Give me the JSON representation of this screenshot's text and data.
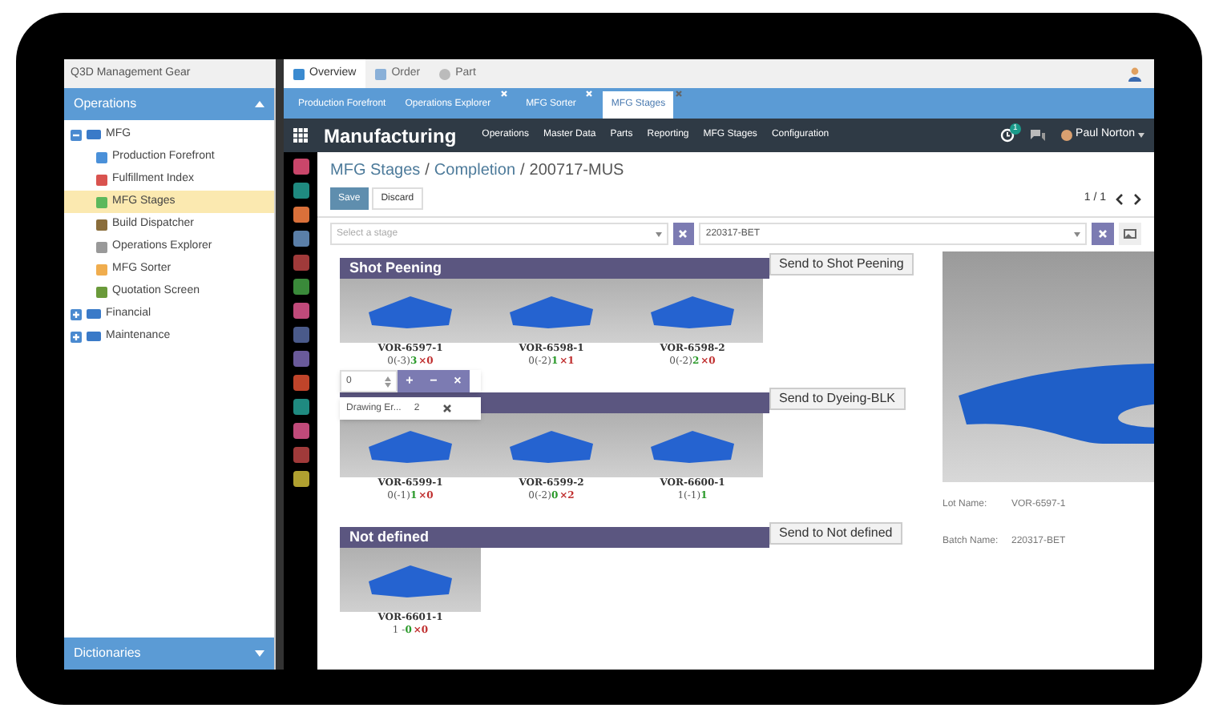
{
  "top_bar": {
    "app_title": "Q3D Management Gear",
    "tabs": [
      {
        "label": "Overview",
        "selected": true
      },
      {
        "label": "Order",
        "selected": false
      },
      {
        "label": "Part",
        "selected": false
      }
    ]
  },
  "sidebar": {
    "header": "Operations",
    "footer": "Dictionaries",
    "tree": [
      {
        "label": "MFG",
        "expanded": true,
        "children": [
          {
            "label": "Production Forefront",
            "selected": false,
            "color": "#4a90d9"
          },
          {
            "label": "Fulfillment Index",
            "selected": false,
            "color": "#d9534f"
          },
          {
            "label": "MFG Stages",
            "selected": true,
            "color": "#5cb85c"
          },
          {
            "label": "Build Dispatcher",
            "selected": false,
            "color": "#8a6d3b"
          },
          {
            "label": "Operations Explorer",
            "selected": false,
            "color": "#999999"
          },
          {
            "label": "MFG Sorter",
            "selected": false,
            "color": "#f0ad4e"
          },
          {
            "label": "Quotation Screen",
            "selected": false,
            "color": "#6a9a3a"
          }
        ]
      },
      {
        "label": "Financial",
        "expanded": false
      },
      {
        "label": "Maintenance",
        "expanded": false
      }
    ]
  },
  "doc_tabs": [
    {
      "label": "Production Forefront",
      "closable": false,
      "selected": false
    },
    {
      "label": "Operations Explorer",
      "closable": true,
      "selected": false
    },
    {
      "label": "MFG Sorter",
      "closable": true,
      "selected": false
    },
    {
      "label": "MFG Stages",
      "closable": true,
      "selected": true
    }
  ],
  "navbar": {
    "title": "Manufacturing",
    "menu": [
      "Operations",
      "Master Data",
      "Parts",
      "Reporting",
      "MFG Stages",
      "Configuration"
    ],
    "notification_count": "1",
    "user": "Paul Norton"
  },
  "app_icons": [
    {
      "color": "#c9466a"
    },
    {
      "color": "#1f8a80"
    },
    {
      "color": "#d9703a"
    },
    {
      "color": "#5a7fa8"
    },
    {
      "color": "#a03a3a"
    },
    {
      "color": "#3a8a3a"
    },
    {
      "color": "#c04a7a"
    },
    {
      "color": "#4a5a8a"
    },
    {
      "color": "#6a5a9a"
    },
    {
      "color": "#c0442a"
    },
    {
      "color": "#1f8a80"
    },
    {
      "color": "#c04a7a"
    },
    {
      "color": "#a03a3a"
    },
    {
      "color": "#b0a030"
    }
  ],
  "breadcrumb": {
    "separator": "/",
    "items": [
      "MFG Stages",
      "Completion",
      "200717-MUS"
    ]
  },
  "buttons": [
    "Save",
    "Discard"
  ],
  "pager": "1 / 1",
  "filters": {
    "stage_placeholder": "Select a stage",
    "batch": "220317-BET"
  },
  "groups": [
    {
      "title": "Shot Peening",
      "action": "Send to Shot Peening",
      "parts": [
        {
          "lot": "VOR-6597-1",
          "count": "0(-3)",
          "good": "3",
          "bad": "×0"
        },
        {
          "lot": "VOR-6598-1",
          "count": "0(-2)",
          "good": "1",
          "bad": "×1"
        },
        {
          "lot": "VOR-6598-2",
          "count": "0(-2)",
          "good": "2",
          "bad": "×0"
        }
      ]
    },
    {
      "action": "Send to Dyeing-BLK",
      "parts": [
        {
          "lot": "VOR-6599-1",
          "count": "0(-1)",
          "good": "1",
          "bad": "×0"
        },
        {
          "lot": "VOR-6599-2",
          "count": "0(-2)",
          "good": "0",
          "bad": "×2"
        },
        {
          "lot": "VOR-6600-1",
          "count": "1(-1)",
          "good": "1"
        }
      ]
    },
    {
      "title": "Not defined",
      "action": "Send to Not defined",
      "parts": [
        {
          "lot": "VOR-6601-1",
          "count": "1 -",
          "good": "0",
          "bad": "×0"
        }
      ]
    }
  ],
  "quantity_popup": {
    "value": "0",
    "buttons": [
      "+",
      "−",
      "×"
    ],
    "tooltip": {
      "label": "Drawing Er...",
      "value": "2"
    }
  },
  "details": [
    {
      "label": "Lot Name:",
      "value": "VOR-6597-1"
    },
    {
      "label": "Batch Name:",
      "value": "220317-BET"
    }
  ]
}
